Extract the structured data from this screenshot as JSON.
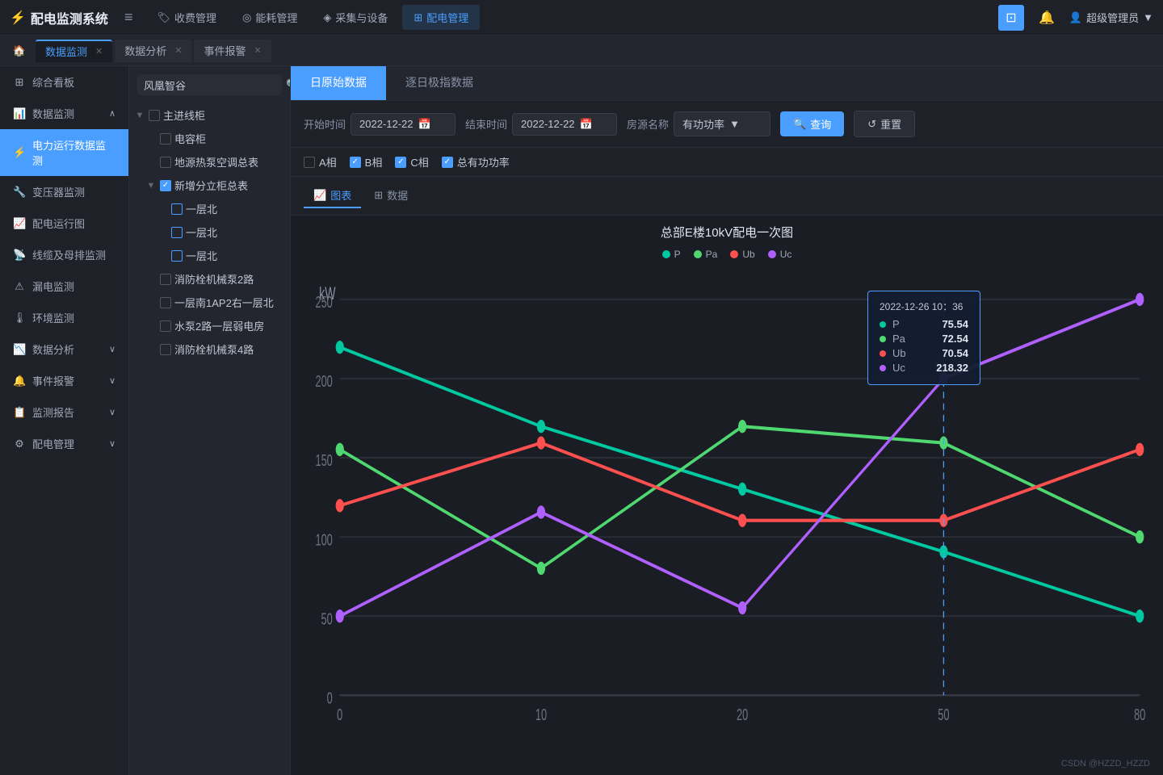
{
  "app": {
    "brand": "配电监测系统",
    "brand_icon": "⚡"
  },
  "topnav": {
    "menu_icon": "≡",
    "items": [
      {
        "label": "收费管理",
        "icon": "🏷",
        "active": false
      },
      {
        "label": "能耗管理",
        "icon": "◎",
        "active": false
      },
      {
        "label": "采集与设备",
        "icon": "◈",
        "active": false
      },
      {
        "label": "配电管理",
        "icon": "⊞",
        "active": true
      }
    ],
    "right": {
      "screen_icon": "⊡",
      "bell_icon": "🔔",
      "user_label": "超级管理员"
    }
  },
  "tabs": [
    {
      "label": "综合看板",
      "active": false,
      "closable": false,
      "home": true
    },
    {
      "label": "数据监测",
      "active": true,
      "closable": true
    },
    {
      "label": "数据分析",
      "active": false,
      "closable": true
    },
    {
      "label": "事件报警",
      "active": false,
      "closable": true
    }
  ],
  "sidebar": {
    "sections": [
      {
        "icon": "⊞",
        "label": "综合看板",
        "active": false,
        "arrow": ""
      },
      {
        "icon": "📊",
        "label": "数据监测",
        "active": true,
        "arrow": "∧"
      },
      {
        "icon": "⚡",
        "label": "电力运行数据监测",
        "active": true,
        "isChild": true
      },
      {
        "icon": "🔧",
        "label": "变压器监测",
        "active": false,
        "isChild": true
      },
      {
        "icon": "📈",
        "label": "配电运行图",
        "active": false,
        "isChild": true
      },
      {
        "icon": "📡",
        "label": "线缆及母排监测",
        "active": false,
        "isChild": true
      },
      {
        "icon": "⚠",
        "label": "漏电监测",
        "active": false,
        "isChild": true
      },
      {
        "icon": "🌡",
        "label": "环境监测",
        "active": false,
        "isChild": true
      },
      {
        "icon": "📉",
        "label": "数据分析",
        "active": false,
        "arrow": "∨"
      },
      {
        "icon": "🔔",
        "label": "事件报警",
        "active": false,
        "arrow": "∨"
      },
      {
        "icon": "📋",
        "label": "监测报告",
        "active": false,
        "arrow": "∨"
      },
      {
        "icon": "⚙",
        "label": "配电管理",
        "active": false,
        "arrow": "∨"
      }
    ]
  },
  "tree": {
    "search_placeholder": "风凰智谷",
    "nodes": [
      {
        "level": 0,
        "expand": "▼",
        "checked": false,
        "partial": false,
        "label": "主进线柜"
      },
      {
        "level": 1,
        "expand": "",
        "checked": false,
        "partial": false,
        "label": "电容柜"
      },
      {
        "level": 1,
        "expand": "",
        "checked": false,
        "partial": false,
        "label": "地源热泵空调总表"
      },
      {
        "level": 1,
        "expand": "▼",
        "checked": true,
        "partial": false,
        "label": "新增分立柜总表"
      },
      {
        "level": 2,
        "expand": "",
        "checked": false,
        "partial": false,
        "label": "一层北"
      },
      {
        "level": 2,
        "expand": "",
        "checked": false,
        "partial": false,
        "label": "一层北"
      },
      {
        "level": 2,
        "expand": "",
        "checked": false,
        "partial": false,
        "label": "一层北"
      },
      {
        "level": 1,
        "expand": "",
        "checked": false,
        "partial": false,
        "label": "消防栓机械泵2路"
      },
      {
        "level": 1,
        "expand": "",
        "checked": false,
        "partial": false,
        "label": "一层南1AP2右一层北"
      },
      {
        "level": 1,
        "expand": "",
        "checked": false,
        "partial": false,
        "label": "水泵2路一层弱电房"
      },
      {
        "level": 1,
        "expand": "",
        "checked": false,
        "partial": false,
        "label": "消防栓机械泵4路"
      }
    ]
  },
  "main": {
    "tabs": [
      {
        "label": "日原始数据",
        "active": true
      },
      {
        "label": "逐日极指数据",
        "active": false
      }
    ],
    "start_label": "开始时间",
    "start_value": "2022-12-22",
    "end_label": "结束时间",
    "end_value": "2022-12-22",
    "source_label": "房源名称",
    "source_value": "有功功率",
    "query_label": "查询",
    "reset_label": "重置",
    "checkboxes": [
      {
        "label": "A相",
        "checked": false
      },
      {
        "label": "B相",
        "checked": true
      },
      {
        "label": "C相",
        "checked": true
      },
      {
        "label": "总有功功率",
        "checked": true
      }
    ],
    "chart_tabs": [
      {
        "label": "图表",
        "icon": "📈",
        "active": true
      },
      {
        "label": "数据",
        "icon": "⊞",
        "active": false
      }
    ],
    "chart": {
      "title": "总部E楼10kV配电一次图",
      "y_label": "kW",
      "legend": [
        {
          "label": "P",
          "color": "#00c8a0"
        },
        {
          "label": "Pa",
          "color": "#50d870"
        },
        {
          "label": "Ub",
          "color": "#ff5050"
        },
        {
          "label": "Uc",
          "color": "#b060ff"
        }
      ],
      "x_ticks": [
        0,
        10,
        20,
        50,
        80
      ],
      "y_ticks": [
        0,
        50,
        100,
        150,
        200,
        250
      ],
      "tooltip": {
        "datetime": "2022-12-26 10：36",
        "rows": [
          {
            "label": "P",
            "color": "#00c8a0",
            "value": "75.54"
          },
          {
            "label": "Pa",
            "color": "#50d870",
            "value": "72.54"
          },
          {
            "label": "Ub",
            "color": "#ff5050",
            "value": "70.54"
          },
          {
            "label": "Uc",
            "color": "#b060ff",
            "value": "218.32"
          }
        ]
      },
      "series": {
        "P": {
          "color": "#00c8a0",
          "points": [
            [
              0,
              220
            ],
            [
              10,
              170
            ],
            [
              20,
              130
            ],
            [
              50,
              90
            ],
            [
              80,
              50
            ]
          ]
        },
        "Pa": {
          "color": "#50d870",
          "points": [
            [
              0,
              155
            ],
            [
              10,
              80
            ],
            [
              20,
              170
            ],
            [
              50,
              160
            ],
            [
              80,
              100
            ]
          ]
        },
        "Ub": {
          "color": "#ff5050",
          "points": [
            [
              0,
              120
            ],
            [
              10,
              160
            ],
            [
              20,
              110
            ],
            [
              50,
              110
            ],
            [
              80,
              155
            ]
          ]
        },
        "Uc": {
          "color": "#b060ff",
          "points": [
            [
              0,
              50
            ],
            [
              10,
              115
            ],
            [
              20,
              55
            ],
            [
              50,
              200
            ],
            [
              80,
              250
            ]
          ]
        }
      }
    }
  },
  "footer": {
    "note": "CSDN @HZZD_HZZD"
  }
}
